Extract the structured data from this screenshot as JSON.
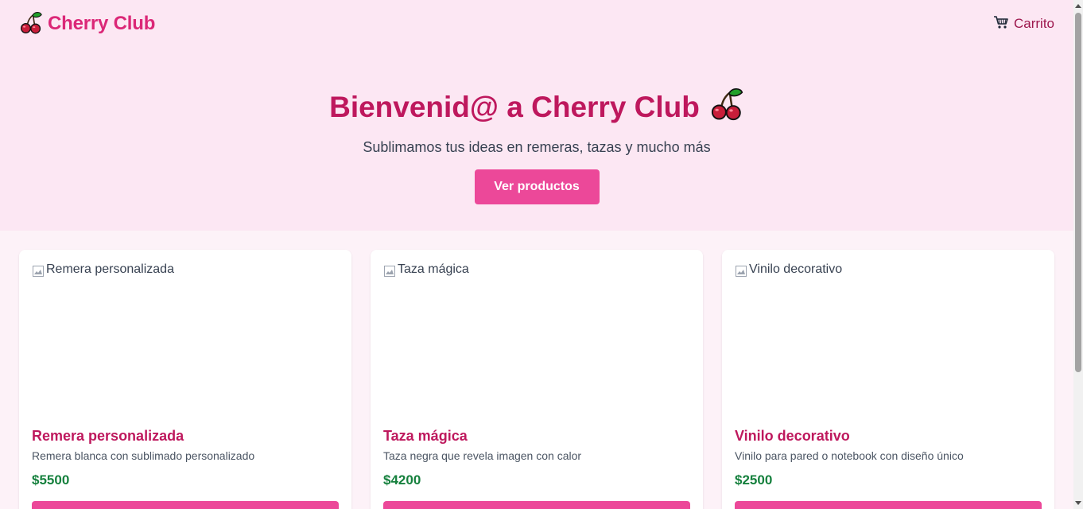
{
  "header": {
    "brand_name": "Cherry Club",
    "brand_icon": "cherry-icon",
    "cart_label": "Carrito",
    "cart_icon": "shopping-cart-icon"
  },
  "hero": {
    "title": "Bienvenid@ a Cherry Club",
    "title_icon": "cherry-icon",
    "subtitle": "Sublimamos tus ideas en remeras, tazas y mucho más",
    "cta_label": "Ver productos"
  },
  "products": [
    {
      "image_alt": "Remera personalizada",
      "name": "Remera personalizada",
      "description": "Remera blanca con sublimado personalizado",
      "price": "$5500"
    },
    {
      "image_alt": "Taza mágica",
      "name": "Taza mágica",
      "description": "Taza negra que revela imagen con calor",
      "price": "$4200"
    },
    {
      "image_alt": "Vinilo decorativo",
      "name": "Vinilo decorativo",
      "description": "Vinilo para pared o notebook con diseño único",
      "price": "$2500"
    }
  ],
  "colors": {
    "brand": "#db2777",
    "accent": "#ec4899",
    "heading": "#be185d",
    "price": "#15803d",
    "hero_bg": "#fce7f3",
    "page_bg": "#fdf2f8"
  }
}
